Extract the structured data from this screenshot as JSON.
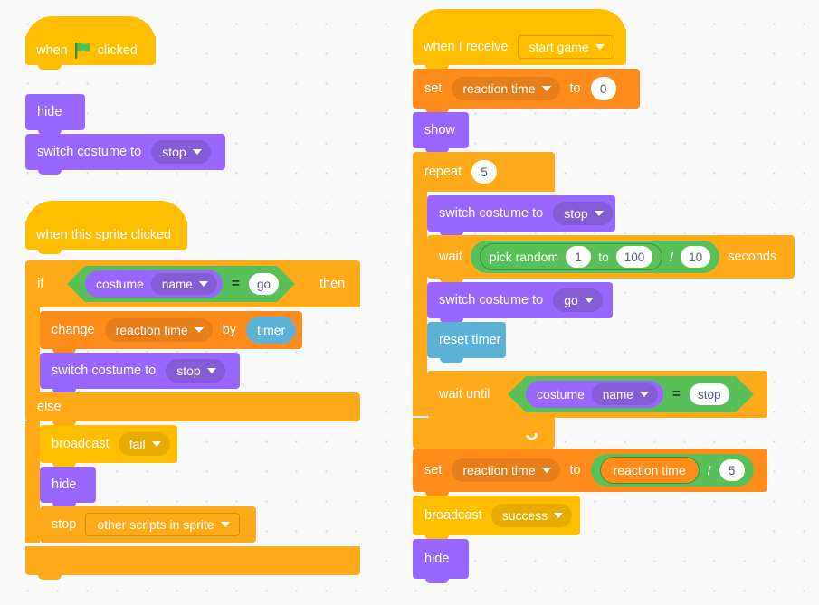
{
  "editor": {
    "name": "scratch-block-canvas",
    "background": "#f9f9f9",
    "dot_color": "#d9d9d9"
  },
  "colors": {
    "events": "#ffbf00",
    "control": "#ffab19",
    "looks": "#9966ff",
    "variables": "#ff8c1a",
    "operators": "#59c059",
    "sensing": "#5cb1d6",
    "input_text": "#575e75"
  },
  "scripts": [
    {
      "id": "script-green-flag",
      "blocks": {
        "hat": {
          "when": "when",
          "flag_icon": "green-flag-icon",
          "clicked": "clicked"
        },
        "hide": "hide",
        "switch_costume": {
          "label": "switch costume to",
          "value": "stop"
        }
      }
    },
    {
      "id": "script-sprite-clicked",
      "blocks": {
        "hat": "when this sprite clicked",
        "if_label": "if",
        "then_label": "then",
        "else_label": "else",
        "condition": {
          "reporter": "costume",
          "dropdown": "name",
          "operator": "=",
          "value": "go"
        },
        "change_var": {
          "label": "change",
          "variable": "reaction time",
          "by_label": "by",
          "value": "timer"
        },
        "switch_costume": {
          "label": "switch costume to",
          "value": "stop"
        },
        "broadcast": {
          "label": "broadcast",
          "value": "fail"
        },
        "hide": "hide",
        "stop": {
          "label": "stop",
          "value": "other scripts in sprite"
        }
      }
    },
    {
      "id": "script-when-i-receive",
      "blocks": {
        "hat": {
          "label": "when I receive",
          "value": "start game"
        },
        "set_var_top": {
          "label": "set",
          "variable": "reaction time",
          "to_label": "to",
          "value": "0"
        },
        "show": "show",
        "repeat": {
          "label": "repeat",
          "value": "5"
        },
        "switch_costume_stop": {
          "label": "switch costume to",
          "value": "stop"
        },
        "wait": {
          "label": "wait",
          "seconds_label": "seconds",
          "pick_random": {
            "label": "pick random",
            "from": "1",
            "to_label": "to",
            "to": "100"
          },
          "divide_op": "/",
          "divisor": "10"
        },
        "switch_costume_go": {
          "label": "switch costume to",
          "value": "go"
        },
        "reset_timer": "reset timer",
        "wait_until": {
          "label": "wait until",
          "reporter": "costume",
          "dropdown": "name",
          "operator": "=",
          "value": "stop"
        },
        "loop_arrow_icon": "loop-arrow-icon",
        "set_var_bottom": {
          "label": "set",
          "variable": "reaction time",
          "to_label": "to",
          "operand": "reaction time",
          "operator": "/",
          "divisor": "5"
        },
        "broadcast": {
          "label": "broadcast",
          "value": "success"
        },
        "hide": "hide"
      }
    }
  ]
}
